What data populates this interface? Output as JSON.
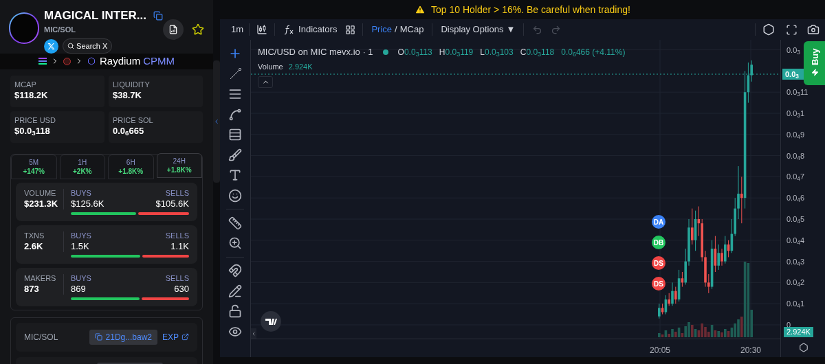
{
  "token": {
    "name": "MAGICAL INTER...",
    "pair": "MIC/SOL",
    "search_label": "Search X"
  },
  "route": {
    "dex": "Raydium",
    "pool_type": "CPMM"
  },
  "stats": [
    {
      "label": "MCAP",
      "value": "$118.2K"
    },
    {
      "label": "LIQUIDITY",
      "value": "$38.7K"
    },
    {
      "label": "PRICE USD",
      "value": "$0.0$_{3}$118"
    },
    {
      "label": "PRICE SOL",
      "value": "0.0$_{6}$665"
    }
  ],
  "timeframes": [
    {
      "label": "5M",
      "change": "+147%",
      "selected": false
    },
    {
      "label": "1H",
      "change": "+2K%",
      "selected": false
    },
    {
      "label": "6H",
      "change": "+1.8K%",
      "selected": false
    },
    {
      "label": "24H",
      "change": "+1.8K%",
      "selected": true
    }
  ],
  "flows": [
    {
      "label": "VOLUME",
      "value": "$231.3K",
      "buys_label": "BUYS",
      "buys": "$125.6K",
      "sells_label": "SELLS",
      "sells": "$105.6K",
      "level": 0.55
    },
    {
      "label": "TXNS",
      "value": "2.6K",
      "buys_label": "BUYS",
      "buys": "1.5K",
      "sells_label": "SELLS",
      "sells": "1.1K",
      "level": 0.59
    },
    {
      "label": "MAKERS",
      "value": "873",
      "buys_label": "BUYS",
      "buys": "869",
      "sells_label": "SELLS",
      "sells": "630",
      "level": 0.58
    }
  ],
  "pool": {
    "label": "MIC/SOL",
    "address": "21Dg...baw2",
    "explorer": "EXP"
  },
  "warning": "Top 10 Holder > 16%. Be careful when trading!",
  "toolbar": {
    "interval": "1m",
    "indicators": "Indicators",
    "modes": [
      {
        "label": "Price",
        "selected": true
      },
      {
        "label": "MCap",
        "selected": false
      }
    ],
    "separator": "/",
    "display_options": "Display Options",
    "caret": "▼"
  },
  "legend": {
    "title": "MIC/USD on MIC mevx.io · 1",
    "ohlc": [
      {
        "key": "O",
        "value": "0.0$_{3}$113"
      },
      {
        "key": "H",
        "value": "0.0$_{3}$119"
      },
      {
        "key": "L",
        "value": "0.0$_{3}$103"
      },
      {
        "key": "C",
        "value": "0.0$_{3}$118"
      }
    ],
    "change": "0.0$_{6}$466 (+4.11%)",
    "volume_label": "Volume",
    "volume": "2.924K"
  },
  "markers": [
    {
      "label": "DA",
      "color": "#3b82f6"
    },
    {
      "label": "DB",
      "color": "#22c55e"
    },
    {
      "label": "DS",
      "color": "#ef4444"
    },
    {
      "label": "DS",
      "color": "#ef4444"
    }
  ],
  "y_axis": [
    "0.0$_{3}$",
    "0.0$_{3}$11",
    "0.0$_{3}$1",
    "0.0$_{4}$9",
    "0.0$_{4}$8",
    "0.0$_{4}$7",
    "0.0$_{4}$6",
    "0.0$_{4}$5",
    "0.0$_{4}$4",
    "0.0$_{4}$3",
    "0.0$_{4}$2",
    "0.0$_{4}$1",
    "0"
  ],
  "price_tag": "0.0$_{3}$",
  "volume_tag": "2.924K",
  "x_axis": [
    "20:05",
    "20:30"
  ],
  "buy_button": "Buy"
}
